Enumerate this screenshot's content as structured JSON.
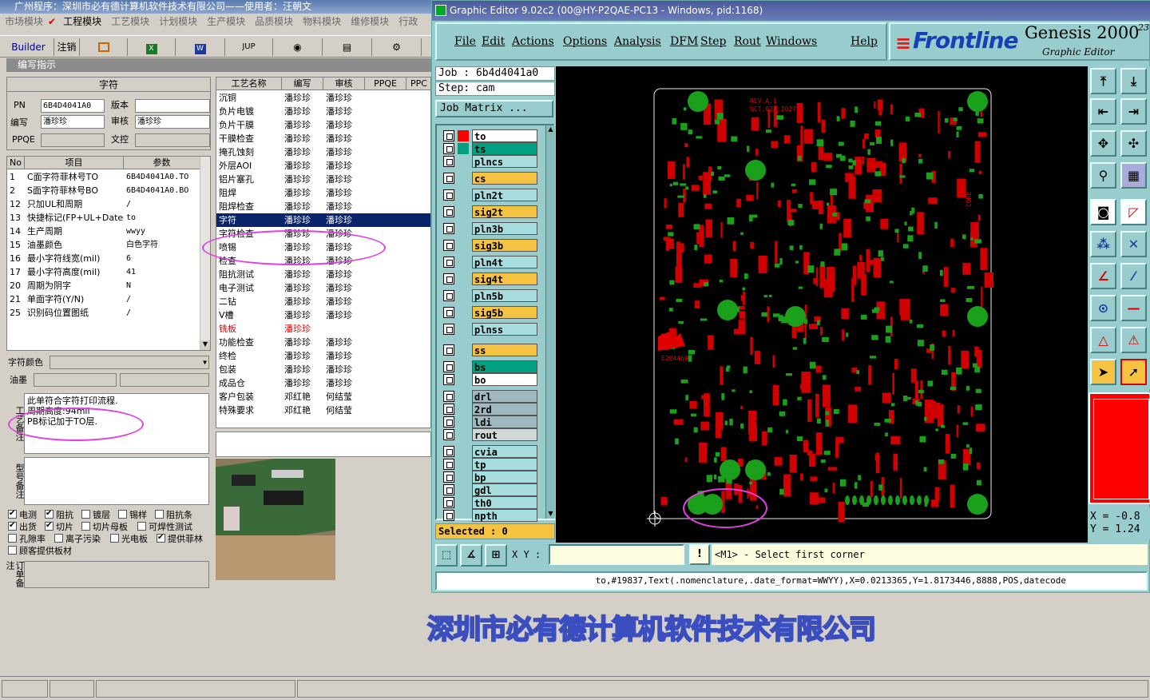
{
  "left_app": {
    "title": "广州程序：深圳市必有德计算机软件技术有限公司——使用者：汪朝文",
    "menu": [
      "市场模块",
      "工程模块",
      "工艺模块",
      "计划模块",
      "生产模块",
      "品质模块",
      "物料模块",
      "维修模块",
      "行政"
    ],
    "menu_active": "工程模块",
    "toolbar": {
      "builder": "Builder",
      "logout": "注销",
      "jup": "JUP"
    },
    "section_title": "编写指示",
    "char_title": "字符",
    "form": {
      "pn_label": "PN",
      "pn_value": "6B4D4041A0",
      "version_label": "版本",
      "version_value": "",
      "author_label": "编写",
      "author_value": "潘珍珍",
      "review_label": "审核",
      "review_value": "潘珍珍",
      "ppqe_label": "PPQE",
      "ppqe_value": "",
      "control_label": "文控",
      "control_value": ""
    },
    "params": {
      "headers": [
        "No",
        "项目",
        "参数"
      ],
      "rows": [
        [
          "1",
          "C面字符菲林号TO",
          "6B4D4041A0.TO"
        ],
        [
          "2",
          "S面字符菲林号BO",
          "6B4D4041A0.BO"
        ],
        [
          "12",
          "只加UL和周期",
          "/"
        ],
        [
          "13",
          "快捷标记(FP+UL+DateCo",
          "to"
        ],
        [
          "14",
          "生产周期",
          "wwyy"
        ],
        [
          "15",
          "油墨颜色",
          "白色字符"
        ],
        [
          "16",
          "最小字符线宽(mil)",
          "6"
        ],
        [
          "17",
          "最小字符高度(mil)",
          "41"
        ],
        [
          "20",
          "周期为阴字",
          "N"
        ],
        [
          "21",
          "单面字符(Y/N)",
          "/"
        ],
        [
          "25",
          "识别码位置图纸",
          "/"
        ]
      ]
    },
    "char_color_label": "字符颜色",
    "ink_label": "油墨",
    "notes_label": "工艺备注",
    "notes_lines": [
      "此单符合字符打印流程.",
      "周期高度:94mil",
      "PB标记加于TO层."
    ],
    "model_label": "型号备注",
    "order_label": "订单备注",
    "checks": [
      [
        {
          "t": "电测",
          "on": true
        },
        {
          "t": "阻抗",
          "on": true
        },
        {
          "t": "镀层",
          "on": false
        },
        {
          "t": "锡样",
          "on": false
        },
        {
          "t": "阻抗条",
          "on": false
        }
      ],
      [
        {
          "t": "出货",
          "on": true
        },
        {
          "t": "切片",
          "on": true
        },
        {
          "t": "切片母板",
          "on": false
        },
        {
          "t": "可焊性测试",
          "on": false
        }
      ],
      [
        {
          "t": "孔隙率",
          "on": false
        },
        {
          "t": "离子污染",
          "on": false
        },
        {
          "t": "光电板",
          "on": false
        },
        {
          "t": "提供菲林",
          "on": true
        }
      ],
      [
        {
          "t": "顾客提供板材",
          "on": false
        }
      ]
    ],
    "process": {
      "headers": [
        "工艺名称",
        "编写",
        "审核",
        "PPQE",
        "PPC"
      ],
      "rows": [
        [
          "沉铜",
          "潘珍珍",
          "潘珍珍"
        ],
        [
          "负片电镀",
          "潘珍珍",
          "潘珍珍"
        ],
        [
          "负片干膜",
          "潘珍珍",
          "潘珍珍"
        ],
        [
          "干膜检查",
          "潘珍珍",
          "潘珍珍"
        ],
        [
          "掩孔蚀刻",
          "潘珍珍",
          "潘珍珍"
        ],
        [
          "外层AOI",
          "潘珍珍",
          "潘珍珍"
        ],
        [
          "铝片塞孔",
          "潘珍珍",
          "潘珍珍"
        ],
        [
          "阻焊",
          "潘珍珍",
          "潘珍珍"
        ],
        [
          "阻焊检查",
          "潘珍珍",
          "潘珍珍"
        ],
        [
          "字符",
          "潘珍珍",
          "潘珍珍"
        ],
        [
          "字符检查",
          "潘珍珍",
          "潘珍珍"
        ],
        [
          "喷锡",
          "潘珍珍",
          "潘珍珍"
        ],
        [
          "检查",
          "潘珍珍",
          "潘珍珍"
        ],
        [
          "阻抗测试",
          "潘珍珍",
          "潘珍珍"
        ],
        [
          "电子测试",
          "潘珍珍",
          "潘珍珍"
        ],
        [
          "二钻",
          "潘珍珍",
          "潘珍珍"
        ],
        [
          "V槽",
          "潘珍珍",
          "潘珍珍"
        ],
        [
          "铣板",
          "潘珍珍",
          ""
        ],
        [
          "功能检查",
          "潘珍珍",
          "潘珍珍"
        ],
        [
          "终检",
          "潘珍珍",
          "潘珍珍"
        ],
        [
          "包装",
          "潘珍珍",
          "潘珍珍"
        ],
        [
          "成品仓",
          "潘珍珍",
          "潘珍珍"
        ],
        [
          "客户包装",
          "邓红艳",
          "何结莹"
        ],
        [
          "特殊要求",
          "邓红艳",
          "何结莹"
        ]
      ],
      "selected": "字符",
      "red": "铣板"
    }
  },
  "editor": {
    "title": "Graphic Editor 9.02c2 (00@HY-P2QAE-PC13 - Windows, pid:1168)",
    "menu": [
      "File",
      "Edit",
      "Actions",
      "Options",
      "Analysis",
      "DFM",
      "Step",
      "Rout",
      "Windows",
      "Help"
    ],
    "brand": "Frontline",
    "product": "Genesis 2000",
    "product_sup": "23",
    "product_sub": "Graphic Editor",
    "job_label": "Job : 6b4d4041a0",
    "step_label": "Step: cam",
    "job_matrix": "Job Matrix ...",
    "layers": [
      {
        "n": "to",
        "c": "#ffffff",
        "m": "#ff0000"
      },
      {
        "n": "ts",
        "c": "#00a080",
        "m": "#00a080"
      },
      {
        "n": "plncs",
        "c": "#a8dde0"
      },
      {
        "n": "cs",
        "c": "#f5c242"
      },
      {
        "n": "pln2t",
        "c": "#a8dde0"
      },
      {
        "n": "sig2t",
        "c": "#f5c242"
      },
      {
        "n": "pln3b",
        "c": "#a8dde0"
      },
      {
        "n": "sig3b",
        "c": "#f5c242"
      },
      {
        "n": "pln4t",
        "c": "#a8dde0"
      },
      {
        "n": "sig4t",
        "c": "#f5c242"
      },
      {
        "n": "pln5b",
        "c": "#a8dde0"
      },
      {
        "n": "sig5b",
        "c": "#f5c242"
      },
      {
        "n": "plnss",
        "c": "#a8dde0"
      },
      {
        "n": "ss",
        "c": "#f5c242"
      },
      {
        "n": "bs",
        "c": "#00a080"
      },
      {
        "n": "bo",
        "c": "#ffffff"
      },
      {
        "n": "drl",
        "c": "#a0b8c0"
      },
      {
        "n": "2rd",
        "c": "#a0b8c0"
      },
      {
        "n": "ldi",
        "c": "#a0b8c0"
      },
      {
        "n": "rout",
        "c": "#d0d8d8"
      },
      {
        "n": "cvia",
        "c": "#a8dde0"
      },
      {
        "n": "tp",
        "c": "#a8dde0"
      },
      {
        "n": "bp",
        "c": "#a8dde0"
      },
      {
        "n": "gdl",
        "c": "#a8dde0"
      },
      {
        "n": "th0",
        "c": "#a8dde0"
      },
      {
        "n": "npth",
        "c": "#a8dde0"
      }
    ],
    "selected": "Selected : 0",
    "xy_label": "X Y :",
    "xy_value": "",
    "prompt": "<M1> - Select first corner",
    "coord_x": "X = -0.8",
    "coord_y": "Y = 1.24",
    "status": "to,#19837,Text(.nomenclature,.date_format=WWYY),X=0.0213365,Y=1.8173446,8888,POS,datecode",
    "pcb_text": {
      "rev": "REV.A.1",
      "nct": "NCT.021.3027",
      "core": "CORE",
      "code": "E204469"
    }
  },
  "banner": "深圳市必有德计算机软件技术有限公司",
  "colors": {
    "pcb_bg": "#000000",
    "trace": "#e00000",
    "pad": "#1aa01a",
    "panel": "#99cccc",
    "highlight": "#e040e0"
  }
}
